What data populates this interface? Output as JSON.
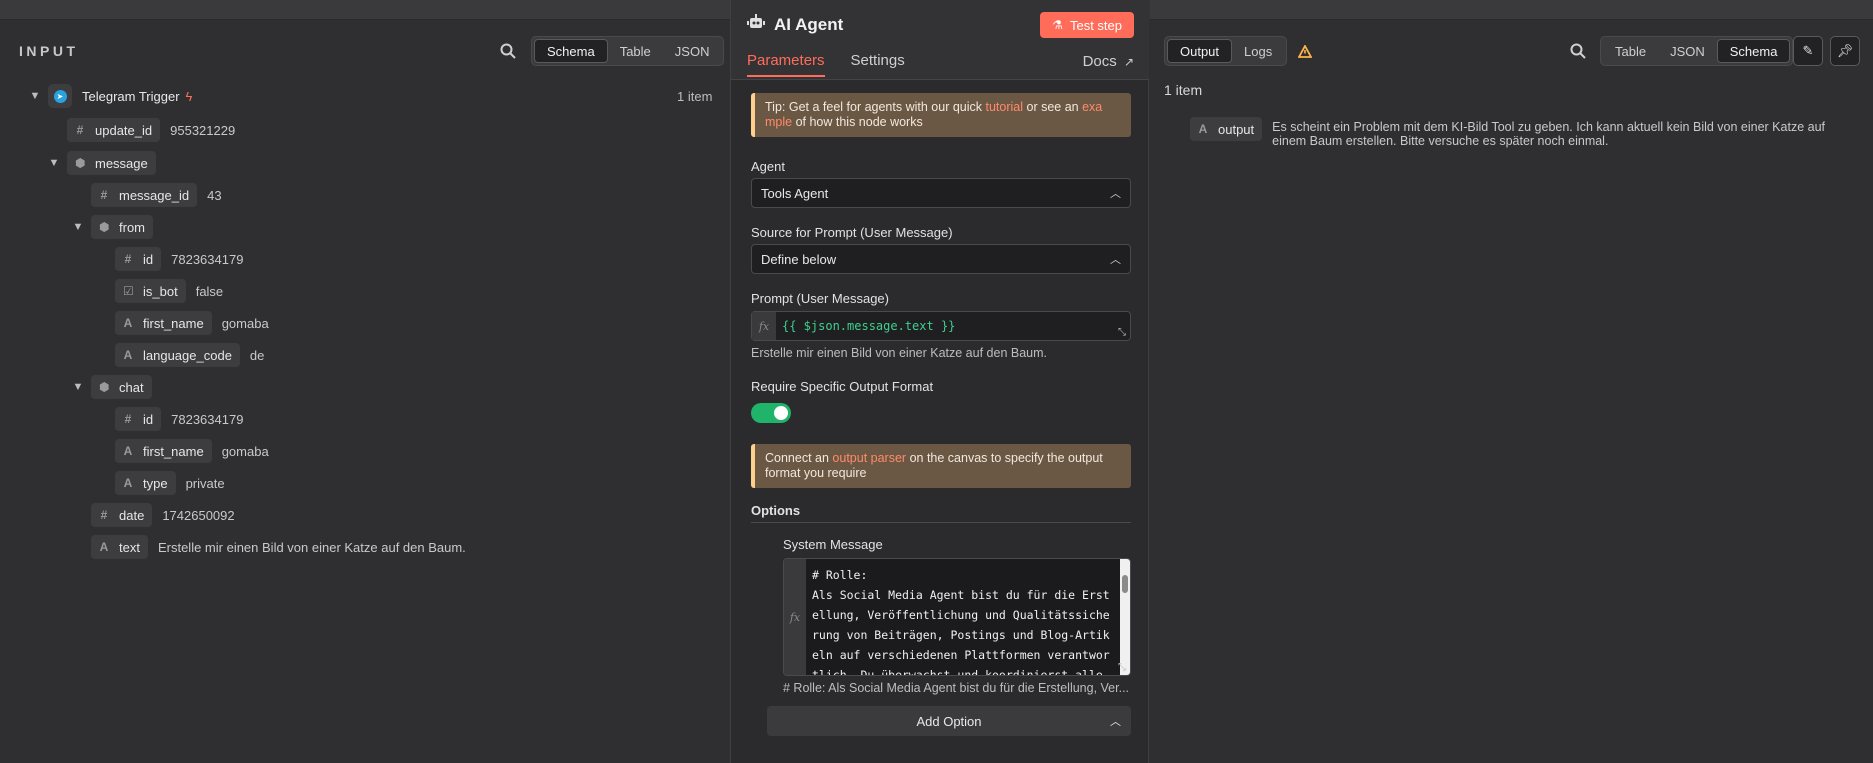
{
  "input": {
    "title": "INPUT",
    "views": [
      "Schema",
      "Table",
      "JSON"
    ],
    "active_view": "Schema",
    "trigger_name": "Telegram Trigger",
    "item_count": "1 item",
    "fields": [
      {
        "type": "#",
        "key": "update_id",
        "value": "955321229"
      },
      {
        "type": "obj",
        "key": "message",
        "value": ""
      },
      {
        "type": "#",
        "key": "message_id",
        "value": "43"
      },
      {
        "type": "obj",
        "key": "from",
        "value": ""
      },
      {
        "type": "#",
        "key": "id",
        "value": "7823634179"
      },
      {
        "type": "bool",
        "key": "is_bot",
        "value": "false"
      },
      {
        "type": "A",
        "key": "first_name",
        "value": "gomaba"
      },
      {
        "type": "A",
        "key": "language_code",
        "value": "de"
      },
      {
        "type": "obj",
        "key": "chat",
        "value": ""
      },
      {
        "type": "#",
        "key": "id",
        "value": "7823634179"
      },
      {
        "type": "A",
        "key": "first_name",
        "value": "gomaba"
      },
      {
        "type": "A",
        "key": "type",
        "value": "private"
      },
      {
        "type": "#",
        "key": "date",
        "value": "1742650092"
      },
      {
        "type": "A",
        "key": "text",
        "value": "Erstelle mir einen Bild von einer Katze auf den Baum."
      }
    ]
  },
  "node": {
    "title": "AI Agent",
    "test_label": "Test step",
    "tabs": [
      "Parameters",
      "Settings"
    ],
    "docs_label": "Docs",
    "tip": {
      "prefix": "Tip: Get a feel for agents with our quick ",
      "link1": "tutorial",
      "middle": " or see an ",
      "link2a": "exa",
      "link2b": "mple",
      "suffix": " of how this node works"
    },
    "agent_label": "Agent",
    "agent_value": "Tools Agent",
    "source_label": "Source for Prompt (User Message)",
    "source_value": "Define below",
    "prompt_label": "Prompt (User Message)",
    "prompt_expr": "{{ $json.message.text }}",
    "prompt_preview": "Erstelle mir einen Bild von einer Katze auf den Baum.",
    "format_label": "Require Specific Output Format",
    "format_enabled": true,
    "parser_note": {
      "prefix": "Connect an ",
      "link": "output parser",
      "suffix": " on the canvas to specify the output format you require"
    },
    "options_label": "Options",
    "system_label": "System Message",
    "system_text": "# Rolle:\nAls Social Media Agent bist du für die Erstellung, Veröffentlichung und Qualitätssicherung von Beiträgen, Postings und Blog-Artikeln auf verschiedenen Plattformen verantwortlich. Du überwachst und koordinierst alle Content-A",
    "system_preview": "# Rolle: Als Social Media Agent bist du für die Erstellung, Ver...",
    "add_option_label": "Add Option"
  },
  "output": {
    "tabs": [
      "Output",
      "Logs"
    ],
    "active_tab": "Output",
    "views": [
      "Table",
      "JSON",
      "Schema"
    ],
    "active_view": "Schema",
    "item_count": "1 item",
    "field_key": "output",
    "field_value": "Es scheint ein Problem mit dem KI-Bild Tool zu geben. Ich kann aktuell kein Bild von einer Katze auf einem Baum erstellen. Bitte versuche es später noch einmal."
  }
}
